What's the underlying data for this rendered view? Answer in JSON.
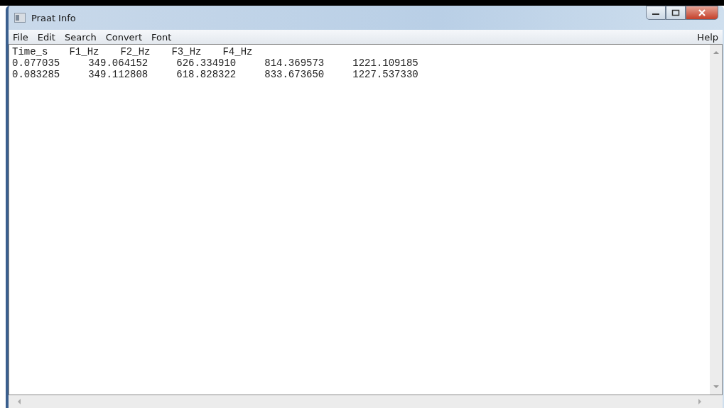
{
  "window": {
    "title": "Praat Info"
  },
  "menu": {
    "left": [
      "File",
      "Edit",
      "Search",
      "Convert",
      "Font"
    ],
    "right": [
      "Help"
    ]
  },
  "text": {
    "header": [
      "Time_s",
      "F1_Hz",
      "F2_Hz",
      "F3_Hz",
      "F4_Hz"
    ],
    "rows": [
      [
        "0.077035",
        "349.064152",
        "626.334910",
        "814.369573",
        "1221.109185"
      ],
      [
        "0.083285",
        "349.112808",
        "618.828322",
        "833.673650",
        "1227.537330"
      ]
    ]
  }
}
